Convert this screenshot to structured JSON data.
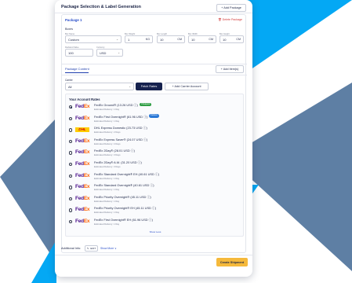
{
  "header": {
    "title": "Package Selection & Label Generation",
    "add_package_label": "+ Add Package"
  },
  "package": {
    "title": "Package 1",
    "delete_label": "Delete Package",
    "boxes_label": "Boxes",
    "box_name": {
      "label": "Box Name",
      "value": "Custom"
    },
    "box_weight": {
      "label": "Box Weight",
      "value": "1",
      "unit": "KG"
    },
    "box_length": {
      "label": "Box Length",
      "value": "10",
      "unit": "CM"
    },
    "box_width": {
      "label": "Box Width",
      "value": "10",
      "unit": "CM"
    },
    "box_height": {
      "label": "Box Height",
      "value": "10",
      "unit": "CM"
    },
    "declared_value": {
      "label": "Declared Value",
      "value": "100"
    },
    "currency": {
      "label": "Currency",
      "value": "USD"
    }
  },
  "tabs": {
    "package_content": "Package Content",
    "add_items_label": "+ Add Item(s)"
  },
  "carrier": {
    "label": "Carrier",
    "value": "All",
    "fetch_rates_label": "Fetch Rates",
    "add_carrier_label": "+ Add Carrier Account"
  },
  "rates": {
    "title": "Your Account Rates",
    "show_less": "Show Less",
    "items": [
      {
        "carrier": "fedex",
        "name": "FedEx Ground® (13.26 USD ⓘ)",
        "sub": "Estimated Delivery: 1 Day",
        "badge": "Cheapest",
        "badge_color": "#2f9e44",
        "selected": true
      },
      {
        "carrier": "fedex",
        "name": "FedEx First Overnight® (61.96 USD ⓘ)",
        "sub": "Estimated Delivery: 1 Day",
        "badge": "Fastest",
        "badge_color": "#2a78d6",
        "selected": false
      },
      {
        "carrier": "dhl",
        "name": "DHL Express Domestic (23.73 USD ⓘ)",
        "sub": "Estimated Delivery: 2 Days",
        "badge": "",
        "selected": false
      },
      {
        "carrier": "fedex",
        "name": "FedEx Express Saver® (24.07 USD ⓘ)",
        "sub": "Estimated Delivery: 4 Days",
        "badge": "",
        "selected": false
      },
      {
        "carrier": "fedex",
        "name": "FedEx 2Day® (28.01 USD ⓘ)",
        "sub": "Estimated Delivery: 3 Days",
        "badge": "",
        "selected": false
      },
      {
        "carrier": "fedex",
        "name": "FedEx 2Day® A.M. (31.20 USD ⓘ)",
        "sub": "Estimated Delivery: 3 Days",
        "badge": "",
        "selected": false
      },
      {
        "carrier": "fedex",
        "name": "FedEx Standard Overnight® EH (40.61 USD ⓘ)",
        "sub": "Estimated Delivery: 1 Day",
        "badge": "",
        "selected": false
      },
      {
        "carrier": "fedex",
        "name": "FedEx Standard Overnight® (40.61 USD ⓘ)",
        "sub": "Estimated Delivery: 1 Day",
        "badge": "",
        "selected": false
      },
      {
        "carrier": "fedex",
        "name": "FedEx Priority Overnight® (45.11 USD ⓘ)",
        "sub": "Estimated Delivery: 1 Day",
        "badge": "",
        "selected": false
      },
      {
        "carrier": "fedex",
        "name": "FedEx Priority Overnight® EH (45.11 USD ⓘ)",
        "sub": "Estimated Delivery: 1 Day",
        "badge": "",
        "selected": false
      },
      {
        "carrier": "fedex",
        "name": "FedEx First Overnight® EH (61.96 USD ⓘ)",
        "sub": "Estimated Delivery: 1 Day",
        "badge": "",
        "selected": false
      }
    ]
  },
  "footer": {
    "additional_info_label": "Additional Info:",
    "edit_label": "EDIT",
    "show_more_label": "Show More ∨",
    "create_shipment_label": "Create Shipment"
  },
  "colors": {
    "accent_blue": "#00a9f4",
    "slate": "#5f7ea3",
    "fedex_purple": "#4d148c",
    "fedex_orange": "#ff6200",
    "primary_dark": "#16224e",
    "cta_yellow": "#f5b93b"
  }
}
